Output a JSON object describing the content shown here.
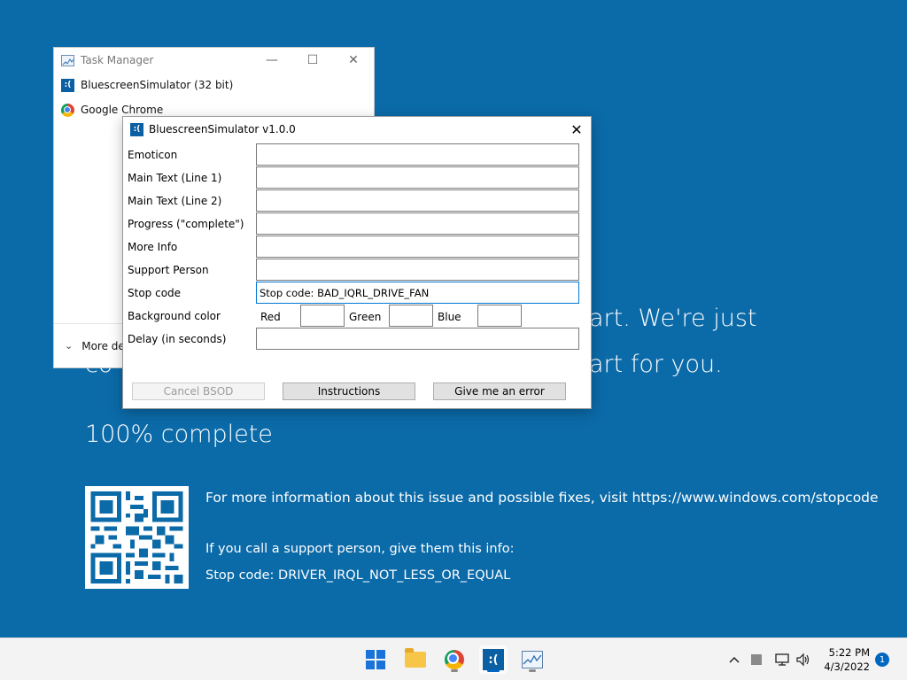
{
  "bsod": {
    "line1_tail": "art. We're just",
    "line2_tail": "art for you.",
    "line2_head": "co",
    "progress": "100% complete",
    "more_info": "For more information about this issue and possible fixes, visit https://www.windows.com/stopcode",
    "support": "If you call a support person, give them this info:",
    "stop_code": "Stop code: DRIVER_IRQL_NOT_LESS_OR_EQUAL"
  },
  "task_manager": {
    "title": "Task Manager",
    "items": [
      {
        "label": "BluescreenSimulator (32 bit)",
        "icon": "bluescreen-simulator-icon"
      },
      {
        "label": "Google Chrome",
        "icon": "chrome-icon"
      }
    ],
    "more_details": "More de"
  },
  "dialog": {
    "title": "BluescreenSimulator v1.0.0",
    "labels": {
      "emoticon": "Emoticon",
      "main1": "Main Text (Line 1)",
      "main2": "Main Text (Line 2)",
      "progress": "Progress (\"complete\")",
      "more_info": "More Info",
      "support": "Support Person",
      "stop_code": "Stop code",
      "bg_color": "Background color",
      "delay": "Delay (in seconds)"
    },
    "values": {
      "emoticon": "",
      "main1": "",
      "main2": "",
      "progress": "",
      "more_info": "",
      "support": "",
      "stop_code": "Stop code: BAD_IQRL_DRIVE_FAN",
      "delay": ""
    },
    "color_labels": {
      "red": "Red",
      "green": "Green",
      "blue": "Blue"
    },
    "buttons": {
      "cancel": "Cancel BSOD",
      "instructions": "Instructions",
      "error": "Give me an error"
    }
  },
  "taskbar": {
    "time": "5:22 PM",
    "date": "4/3/2022",
    "notification_count": "1",
    "tray_chevron": "^"
  }
}
